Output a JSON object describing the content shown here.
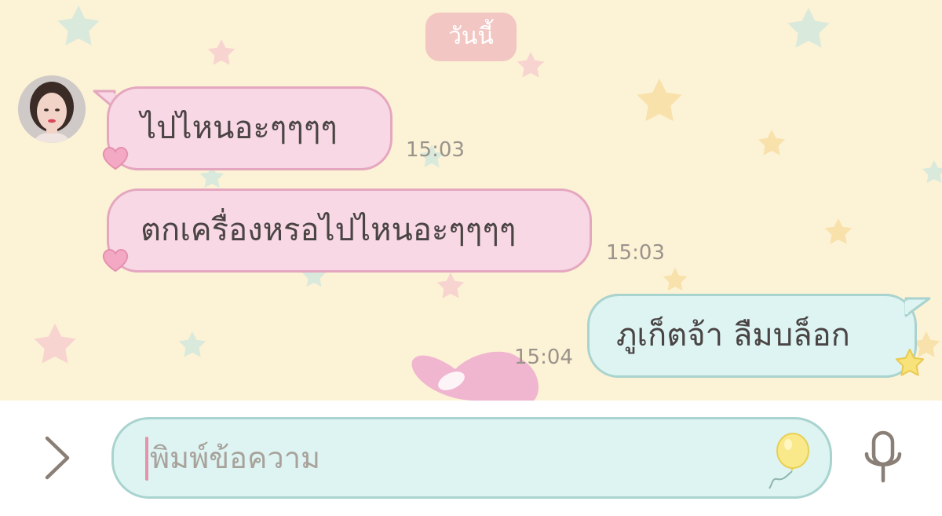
{
  "chat": {
    "date_label": "วันนี้",
    "messages": [
      {
        "direction": "incoming",
        "text": "ไปไหนอะๆๆๆๆ",
        "time": "15:03"
      },
      {
        "direction": "incoming",
        "text": "ตกเครื่องหรอไปไหนอะๆๆๆๆ",
        "time": "15:03"
      },
      {
        "direction": "outgoing",
        "text": "ภูเก็ตจ้า ลืมบล็อก",
        "time": "15:04"
      }
    ]
  },
  "composer": {
    "placeholder": "พิมพ์ข้อความ",
    "expand_icon": "chevron-right-icon",
    "emoji_icon": "balloon-icon",
    "mic_icon": "microphone-icon"
  },
  "colors": {
    "background": "#fcf2d5",
    "incoming_bubble": "#f8d8e4",
    "incoming_border": "#e4a7bf",
    "outgoing_bubble": "#ddf4f2",
    "outgoing_border": "#a9d3cf",
    "date_chip": "#f2c6c3"
  }
}
